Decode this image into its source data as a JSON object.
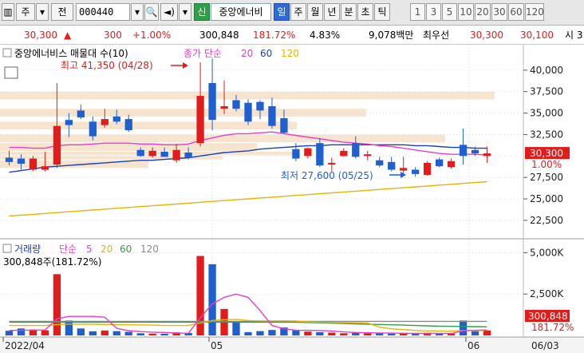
{
  "toolbar": {
    "mode_label": "주",
    "jeon_label": "전",
    "code": "000440",
    "new_badge": "신",
    "stock_name": "중앙에너비",
    "periods": [
      {
        "label": "일",
        "selected": true
      },
      {
        "label": "주",
        "selected": false
      },
      {
        "label": "월",
        "selected": false
      },
      {
        "label": "년",
        "selected": false
      },
      {
        "label": "분",
        "selected": false
      },
      {
        "label": "초",
        "selected": false
      },
      {
        "label": "틱",
        "selected": false
      }
    ],
    "intervals": [
      "1",
      "3",
      "5",
      "10",
      "20",
      "30",
      "60",
      "120"
    ]
  },
  "quote": {
    "price": "30,300",
    "change": "300",
    "change_pct": "+1.00%",
    "volume": "300,848",
    "volume_ratio": "181.72%",
    "turnover": "4.83%",
    "amount": "9,078백만",
    "best_label": "최우선",
    "ask": "30,300",
    "bid": "30,100",
    "trail": "시 3"
  },
  "price_panel": {
    "title": "중앙에너비스 매물대 수(10)",
    "ma_label": "종가 단순",
    "ma_periods": [
      "20",
      "60",
      "120"
    ],
    "high_annotation": "최고 41,350 (04/28)",
    "low_annotation": "최저 27,600 (05/25)",
    "axis_ticks": [
      "40,000",
      "37,500",
      "35,000",
      "32,500",
      "27,500",
      "25,000",
      "22,500"
    ],
    "current_price_label": "30,300",
    "current_pct_label": "1.00%"
  },
  "volume_panel": {
    "title": "거래량",
    "ma_label": "단순",
    "ma_periods": [
      "5",
      "20",
      "60",
      "120"
    ],
    "value_label": "300,848주(181.72%)",
    "axis_ticks": [
      "5,000K",
      "2,500K"
    ],
    "current_label": "300,848",
    "current_pct_label": "181.72%"
  },
  "date_axis": [
    "2022/04",
    "05",
    "06",
    "06/03"
  ],
  "colors": {
    "up": "#e21b1b",
    "down": "#1f5fcf",
    "ma20": "#e83ec6",
    "ma60": "#1c3fb8",
    "ma120": "#e8b400",
    "vol_ma5": "#e83ec6",
    "vol_ma20": "#e8b400",
    "vol_ma60": "#2ea04a",
    "vol_ma120": "#8a8a8a",
    "volume_profile": "#f7e4cf"
  },
  "chart_data": {
    "type": "candlestick",
    "price_unit": "KRW",
    "ylim": [
      21000,
      42500
    ],
    "volume_ylim": [
      0,
      5500
    ],
    "volume_unit": "K",
    "candles": [
      {
        "o": 29800,
        "h": 30600,
        "l": 28900,
        "c": 29300
      },
      {
        "o": 29700,
        "h": 30200,
        "l": 28400,
        "c": 29100
      },
      {
        "o": 28400,
        "h": 30000,
        "l": 28200,
        "c": 29700
      },
      {
        "o": 28400,
        "h": 30500,
        "l": 28200,
        "c": 28800
      },
      {
        "o": 29000,
        "h": 38500,
        "l": 28600,
        "c": 33500
      },
      {
        "o": 34200,
        "h": 35000,
        "l": 32200,
        "c": 33600
      },
      {
        "o": 35300,
        "h": 36000,
        "l": 34300,
        "c": 34500
      },
      {
        "o": 34000,
        "h": 34600,
        "l": 31800,
        "c": 32300
      },
      {
        "o": 33600,
        "h": 35500,
        "l": 33300,
        "c": 34300
      },
      {
        "o": 34600,
        "h": 35400,
        "l": 33700,
        "c": 34000
      },
      {
        "o": 34300,
        "h": 34800,
        "l": 32800,
        "c": 33000
      },
      {
        "o": 30700,
        "h": 31000,
        "l": 29900,
        "c": 30000
      },
      {
        "o": 30000,
        "h": 31000,
        "l": 29800,
        "c": 30600
      },
      {
        "o": 30500,
        "h": 31000,
        "l": 29900,
        "c": 29900
      },
      {
        "o": 29500,
        "h": 31400,
        "l": 29200,
        "c": 30700
      },
      {
        "o": 30400,
        "h": 31000,
        "l": 29600,
        "c": 29800
      },
      {
        "o": 31500,
        "h": 40900,
        "l": 31100,
        "c": 37000
      },
      {
        "o": 38500,
        "h": 41350,
        "l": 33000,
        "c": 34200
      },
      {
        "o": 35500,
        "h": 38800,
        "l": 34900,
        "c": 35800
      },
      {
        "o": 36500,
        "h": 37100,
        "l": 35200,
        "c": 35500
      },
      {
        "o": 36200,
        "h": 36600,
        "l": 33600,
        "c": 34000
      },
      {
        "o": 36300,
        "h": 36500,
        "l": 34300,
        "c": 35300
      },
      {
        "o": 35800,
        "h": 36800,
        "l": 33200,
        "c": 33500
      },
      {
        "o": 34400,
        "h": 35400,
        "l": 32600,
        "c": 32700
      },
      {
        "o": 30800,
        "h": 31500,
        "l": 29400,
        "c": 29700
      },
      {
        "o": 30000,
        "h": 31000,
        "l": 29700,
        "c": 30900
      },
      {
        "o": 31500,
        "h": 32100,
        "l": 28700,
        "c": 28900
      },
      {
        "o": 29000,
        "h": 29800,
        "l": 28200,
        "c": 29200
      },
      {
        "o": 30000,
        "h": 30900,
        "l": 29900,
        "c": 30600
      },
      {
        "o": 31500,
        "h": 32300,
        "l": 29700,
        "c": 29900
      },
      {
        "o": 30000,
        "h": 30600,
        "l": 29500,
        "c": 30200
      },
      {
        "o": 29500,
        "h": 29900,
        "l": 28700,
        "c": 28900
      },
      {
        "o": 29300,
        "h": 29900,
        "l": 28200,
        "c": 28400
      },
      {
        "o": 28300,
        "h": 29900,
        "l": 27900,
        "c": 28600
      },
      {
        "o": 28400,
        "h": 28700,
        "l": 27600,
        "c": 27900
      },
      {
        "o": 27800,
        "h": 29400,
        "l": 27700,
        "c": 29200
      },
      {
        "o": 29600,
        "h": 29800,
        "l": 28700,
        "c": 28800
      },
      {
        "o": 28700,
        "h": 29700,
        "l": 28500,
        "c": 29400
      },
      {
        "o": 31300,
        "h": 33200,
        "l": 29000,
        "c": 30000
      },
      {
        "o": 30700,
        "h": 31100,
        "l": 30000,
        "c": 30300
      },
      {
        "o": 30000,
        "h": 31100,
        "l": 29200,
        "c": 30300
      }
    ],
    "volumes": [
      280,
      420,
      360,
      310,
      3700,
      900,
      420,
      250,
      300,
      260,
      220,
      130,
      110,
      100,
      180,
      150,
      4800,
      4300,
      1600,
      800,
      200,
      260,
      330,
      480,
      300,
      230,
      200,
      170,
      130,
      160,
      130,
      120,
      110,
      110,
      100,
      160,
      130,
      110,
      900,
      250,
      300
    ],
    "ma20": [
      31000,
      31000,
      30900,
      30900,
      31200,
      31300,
      31300,
      31400,
      31500,
      31500,
      31500,
      31400,
      31400,
      31300,
      31300,
      31400,
      31800,
      32100,
      32400,
      32600,
      32600,
      32700,
      32800,
      32600,
      32400,
      32200,
      32000,
      31800,
      31600,
      31500,
      31400,
      31200,
      31100,
      30900,
      30700,
      30500,
      30300,
      30200,
      30200,
      30200,
      30100
    ],
    "ma60": [
      28100,
      28300,
      28500,
      28700,
      28800,
      28900,
      29000,
      29100,
      29200,
      29300,
      29400,
      29500,
      29500,
      29600,
      29700,
      29800,
      30000,
      30200,
      30400,
      30500,
      30600,
      30800,
      30900,
      31000,
      31100,
      31200,
      31200,
      31300,
      31300,
      31300,
      31300,
      31300,
      31300,
      31300,
      31200,
      31200,
      31100,
      31000,
      31000,
      30900,
      30900
    ],
    "ma120": [
      23000,
      23100,
      23200,
      23300,
      23400,
      23500,
      23600,
      23700,
      23800,
      23900,
      24000,
      24100,
      24200,
      24300,
      24400,
      24500,
      24600,
      24700,
      24800,
      24900,
      25000,
      25100,
      25200,
      25300,
      25400,
      25500,
      25600,
      25700,
      25800,
      25900,
      26000,
      26100,
      26200,
      26300,
      26400,
      26500,
      26600,
      26700,
      26800,
      26900,
      27000
    ],
    "vol_ma5": [
      300,
      320,
      320,
      330,
      1000,
      1150,
      1150,
      1150,
      1100,
      430,
      290,
      230,
      200,
      180,
      150,
      130,
      1070,
      1900,
      2300,
      2500,
      2300,
      1500,
      600,
      400,
      320,
      310,
      300,
      270,
      210,
      180,
      160,
      150,
      140,
      130,
      120,
      120,
      120,
      120,
      280,
      310,
      330
    ],
    "vol_ma20": [
      600,
      600,
      600,
      600,
      650,
      680,
      680,
      670,
      660,
      650,
      640,
      630,
      620,
      600,
      600,
      600,
      750,
      900,
      950,
      970,
      900,
      880,
      880,
      880,
      870,
      820,
      800,
      780,
      770,
      760,
      750,
      500,
      400,
      350,
      300,
      280,
      270,
      260,
      300,
      300,
      310
    ],
    "vol_ma60": [
      800,
      800,
      800,
      800,
      800,
      800,
      800,
      800,
      800,
      800,
      800,
      800,
      800,
      800,
      800,
      800,
      800,
      800,
      800,
      800,
      800,
      800,
      800,
      800,
      800,
      780,
      760,
      740,
      720,
      700,
      680,
      660,
      640,
      620,
      600,
      580,
      560,
      550,
      540,
      530,
      520
    ],
    "vol_ma120": [
      850,
      850,
      850,
      850,
      850,
      850,
      850,
      850,
      850,
      850,
      850,
      850,
      850,
      850,
      850,
      850,
      850,
      850,
      850,
      850,
      850,
      850,
      850,
      850,
      850,
      850,
      850,
      850,
      850,
      850,
      850,
      850,
      850,
      850,
      850,
      850,
      850,
      850,
      850,
      850,
      850
    ],
    "volume_profile": [
      {
        "low": 36500,
        "high": 37500,
        "strength": 1.0
      },
      {
        "low": 34500,
        "high": 35500,
        "strength": 0.74
      },
      {
        "low": 33000,
        "high": 34000,
        "strength": 0.6
      },
      {
        "low": 31500,
        "high": 32500,
        "strength": 0.9
      },
      {
        "low": 30500,
        "high": 31500,
        "strength": 0.52
      },
      {
        "low": 30000,
        "high": 30500,
        "strength": 0.6
      },
      {
        "low": 29500,
        "high": 30000,
        "strength": 0.45
      },
      {
        "low": 28500,
        "high": 29500,
        "strength": 0.3
      }
    ]
  }
}
